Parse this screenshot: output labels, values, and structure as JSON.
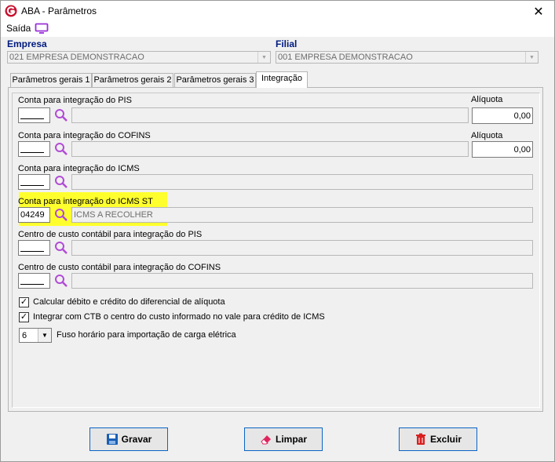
{
  "window": {
    "title": "ABA - Parâmetros"
  },
  "menu": {
    "exit_label": "Saída"
  },
  "empresa": {
    "label": "Empresa",
    "value": "021 EMPRESA DEMONSTRACAO"
  },
  "filial": {
    "label": "Filial",
    "value": "001 EMPRESA DEMONSTRACAO"
  },
  "tabs": [
    {
      "label": "Parâmetros gerais 1"
    },
    {
      "label": "Parâmetros gerais 2"
    },
    {
      "label": "Parâmetros gerais 3"
    },
    {
      "label": "Integração"
    }
  ],
  "form": {
    "pis": {
      "label": "Conta para integração do PIS",
      "code": "",
      "desc": "",
      "aliquota_label": "Alíquota",
      "aliquota": "0,00"
    },
    "cofins": {
      "label": "Conta para integração do COFINS",
      "code": "",
      "desc": "",
      "aliquota_label": "Alíquota",
      "aliquota": "0,00"
    },
    "icms": {
      "label": "Conta para integração do ICMS",
      "code": "",
      "desc": ""
    },
    "icms_st": {
      "label": "Conta para integração do ICMS ST",
      "code": "04249",
      "desc": "ICMS A RECOLHER"
    },
    "cc_pis": {
      "label": "Centro de custo contábil para integração do PIS",
      "code": "",
      "desc": ""
    },
    "cc_cofins": {
      "label": "Centro de custo contábil para integração do COFINS",
      "code": "",
      "desc": ""
    },
    "check_diferencial": {
      "label": "Calcular débito e crédito do diferencial de alíquota",
      "checked": true
    },
    "check_ctb": {
      "label": "Integrar com CTB o centro do custo informado no vale para crédito de ICMS",
      "checked": true
    },
    "fuso": {
      "value": "6",
      "label": "Fuso horário para importação de carga elétrica"
    }
  },
  "buttons": {
    "gravar": "Gravar",
    "limpar": "Limpar",
    "excluir": "Excluir"
  }
}
